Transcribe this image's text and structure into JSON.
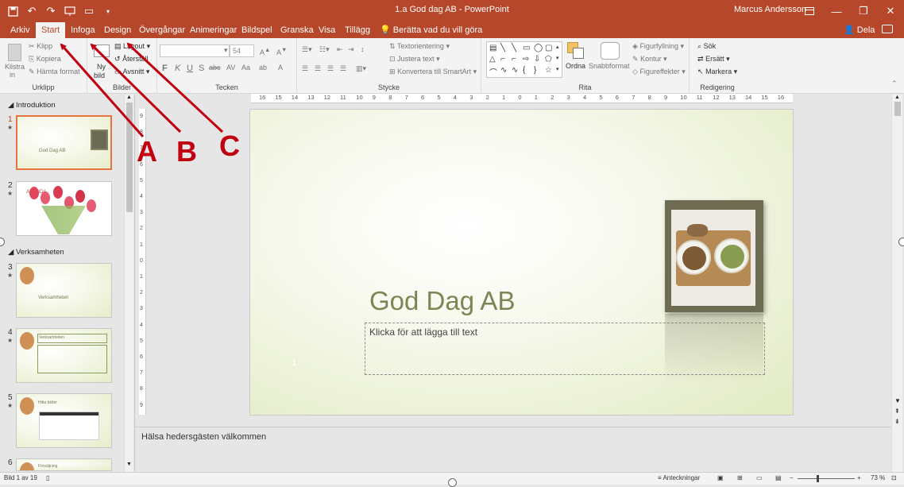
{
  "window": {
    "title": "1.a God dag AB - PowerPoint",
    "user": "Marcus Andersson"
  },
  "tabs": [
    "Arkiv",
    "Start",
    "Infoga",
    "Design",
    "Övergångar",
    "Animeringar",
    "Bildspel",
    "Granska",
    "Visa",
    "Tillägg"
  ],
  "tellme": "Berätta vad du vill göra",
  "share": "Dela",
  "ribbon": {
    "clipboard": {
      "label": "Urklipp",
      "paste": "Klistra",
      "paste2": "in",
      "cut": "Klipp",
      "copy": "Kopiera",
      "format": "Hämta format"
    },
    "slides": {
      "label": "Bilder",
      "new1": "Ny",
      "new2": "bild",
      "layout": "Layout",
      "reset": "Återställ",
      "section": "Avsnitt"
    },
    "font": {
      "label": "Tecken",
      "size": "54"
    },
    "paragraph": {
      "label": "Stycke",
      "direction": "Textorientering",
      "align": "Justera text",
      "smartart": "Konvertera till SmartArt"
    },
    "drawing": {
      "label": "Rita",
      "arrange": "Ordna",
      "quick": "Snabbformat",
      "fill": "Figurfyllning",
      "outline": "Kontur",
      "effects": "Figureffekter"
    },
    "editing": {
      "label": "Redigering",
      "find": "Sök",
      "replace": "Ersätt",
      "select": "Markera"
    }
  },
  "sections": [
    "Introduktion",
    "Verksamheten"
  ],
  "thumbnails": [
    {
      "num": "1",
      "text": "God Dag AB"
    },
    {
      "num": "2",
      "text": "AGENDA"
    },
    {
      "num": "3",
      "text": "Verksamheten"
    },
    {
      "num": "4",
      "text": "Verksamheten"
    },
    {
      "num": "5",
      "text": "Hitta bilder"
    },
    {
      "num": "6",
      "text": "Försäljning"
    }
  ],
  "hruler_ticks": [
    "16",
    "15",
    "14",
    "13",
    "12",
    "11",
    "10",
    "9",
    "8",
    "7",
    "6",
    "5",
    "4",
    "3",
    "2",
    "1",
    "0",
    "1",
    "2",
    "3",
    "4",
    "5",
    "6",
    "7",
    "8",
    "9",
    "10",
    "11",
    "12",
    "13",
    "14",
    "15",
    "16"
  ],
  "vruler_ticks": [
    "9",
    "8",
    "7",
    "6",
    "5",
    "4",
    "3",
    "2",
    "1",
    "0",
    "1",
    "2",
    "3",
    "4",
    "5",
    "6",
    "7",
    "8",
    "9"
  ],
  "slide": {
    "title": "God Dag AB",
    "placeholder": "Klicka för att lägga till text",
    "number": "1"
  },
  "notes": "Hälsa hedersgästen välkommen",
  "status": {
    "slide": "Bild 1 av 19",
    "notes": "Anteckningar",
    "zoom": "73 %"
  },
  "annotations": {
    "a": "A",
    "b": "B",
    "c": "C"
  },
  "colors": {
    "accent": "#b7472a",
    "annotation": "#c0000e",
    "selection": "#e7743e"
  }
}
